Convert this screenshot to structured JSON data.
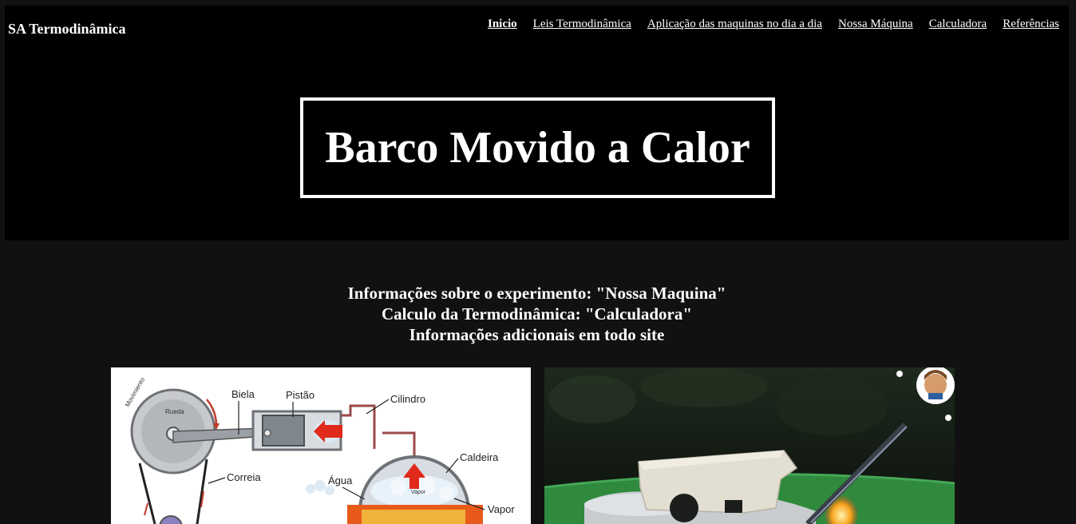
{
  "brand": "SA Termodinâmica",
  "nav": [
    {
      "label": "Inicio",
      "active": true
    },
    {
      "label": "Leis Termodinâmica"
    },
    {
      "label": "Aplicação das maquinas no dia a dia"
    },
    {
      "label": "Nossa Máquina"
    },
    {
      "label": "Calculadora"
    },
    {
      "label": "Referências"
    }
  ],
  "hero": {
    "title": "Barco Movido a Calor"
  },
  "info": {
    "line1": "Informações sobre o experimento: \"Nossa Maquina\"",
    "line2": "Calculo da Termodinâmica: \"Calculadora\"",
    "line3": "Informações adicionais em todo site"
  },
  "diagram": {
    "labels": {
      "movimento": "Movimiento",
      "rueda": "Rueda",
      "biela": "Biela",
      "pistao": "Pistão",
      "cilindro": "Cilindro",
      "caldeira": "Caldeira",
      "correia": "Correia",
      "agua": "Água",
      "vapor_small": "Vapor",
      "vapor": "Vapor"
    }
  },
  "colors": {
    "page_bg": "#121111",
    "header_bg": "#000000",
    "text": "#ffffff"
  }
}
